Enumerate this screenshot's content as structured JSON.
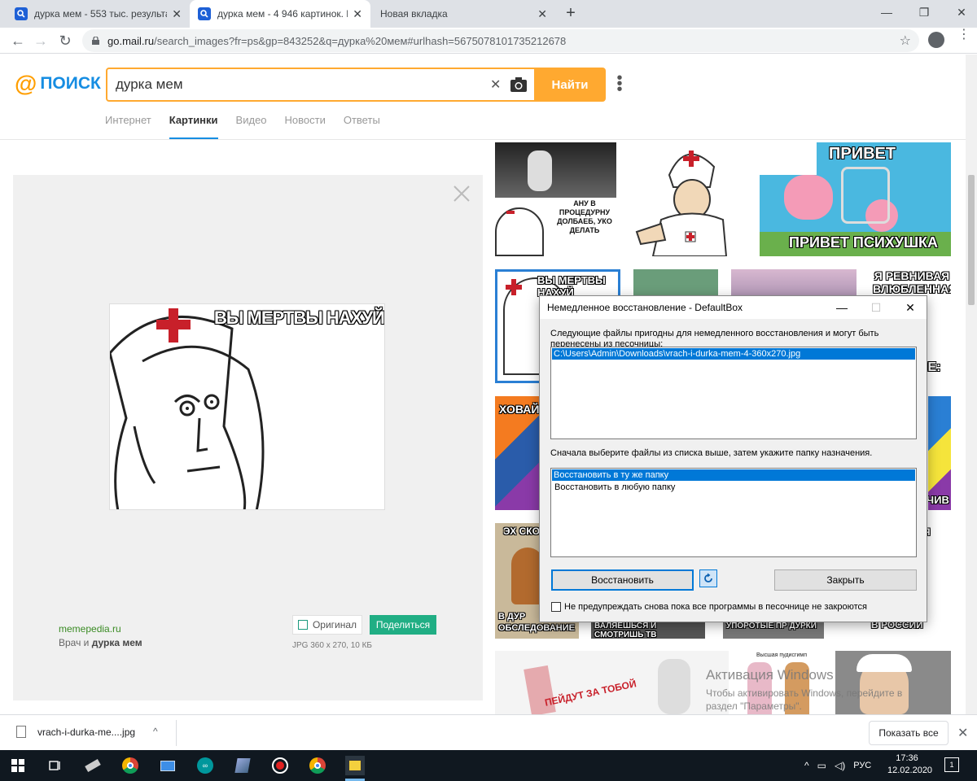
{
  "browser": {
    "tabs": [
      {
        "title": "дурка мем - 553 тыс. результато",
        "active": false
      },
      {
        "title": "дурка мем - 4 946 картинок. По",
        "active": true
      },
      {
        "title": "Новая вкладка",
        "active": false
      }
    ],
    "url_domain": "go.mail.ru",
    "url_path": "/search_images?fr=ps&gp=843252&q=дурка%20мем#urlhash=5675078101735212678"
  },
  "page": {
    "logo": {
      "at": "@",
      "text": "поиск"
    },
    "search": {
      "value": "дурка мем",
      "button": "Найти"
    },
    "nav_tabs": [
      "Интернет",
      "Картинки",
      "Видео",
      "Новости",
      "Ответы"
    ],
    "active_tab": "Картинки",
    "preview": {
      "meme_caption": "ВЫ МЕРТВЫ НАХУЙ",
      "source": "memepedia.ru",
      "desc_prefix": "Врач и ",
      "desc_bold": "дурка мем",
      "original_button": "Оригинал",
      "share_button": "Поделиться",
      "image_info": "JPG 360 x 270, 10 КБ"
    },
    "thumbnails": {
      "t1_text": "АНУ В ПРОЦЕДУРНУ ДОЛБАЕБ, УКО ДЕЛАТЬ",
      "t3_top": "ПРИВЕТ",
      "t3_bottom": "ПРИВЕТ ПСИХУШКА",
      "t4_text": "ВЫ МЕРТВЫ НАХУЙ",
      "t7_text": "Я РЕВНИВАЯ ВЛЮБЛЕННАЯ",
      "t8_text": "ХОВАЙС",
      "t9_text": "ЭХ СКО",
      "t9_bottom": "В ДУР ОБСЛЕДОВАНИЕ",
      "t10_bottom": "ВАЛЯЕШЬСЯ И СМОТРИШЬ ТВ",
      "t11_bottom": "УПОРОТЫЕ ПР ДУРКИ",
      "t12_bottom": "В РОССИИ",
      "t12_top": "ЯЕ:",
      "t13_text": "ЧИВ",
      "t14_text": "Я",
      "t15_text": "ПЕЙДУТ ЗА ТОБОЙ",
      "t16_text": "Высшая пудисгимп"
    },
    "watermark": {
      "line1": "Активация Windows",
      "line2": "Чтобы активировать Windows, перейдите в",
      "line3": "раздел \"Параметры\"."
    }
  },
  "dialog": {
    "title": "Немедленное восстановление - DefaultBox",
    "text1": "Следующие файлы пригодны для немедленного восстановления и могут быть перенесены из песочницы:",
    "file": "C:\\Users\\Admin\\Downloads\\vrach-i-durka-mem-4-360x270.jpg",
    "text2": "Сначала выберите файлы из списка выше, затем укажите папку назначения.",
    "options": [
      "Восстановить в ту же папку",
      "Восстановить в любую папку"
    ],
    "restore_button": "Восстановить",
    "close_button": "Закрыть",
    "checkbox": "Не предупреждать снова пока все программы в песочнице не закроются"
  },
  "downloads": {
    "file": "vrach-i-durka-me....jpg",
    "show_all": "Показать все"
  },
  "taskbar": {
    "lang": "РУС",
    "time": "17:36",
    "date": "12.02.2020",
    "notif_count": "1"
  }
}
